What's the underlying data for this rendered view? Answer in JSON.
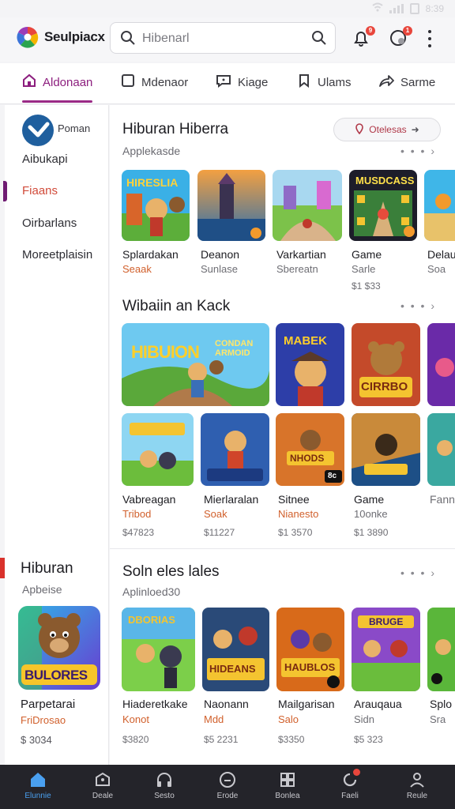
{
  "statusbar": {
    "time": "8:39"
  },
  "app": {
    "name": "Seulpiacx"
  },
  "search": {
    "placeholder": "Hibenarl"
  },
  "topbar": {
    "notif_badge": "9",
    "profile_badge": "1"
  },
  "tabs": [
    {
      "label": "Aldonaan",
      "icon": "home-icon",
      "active": true
    },
    {
      "label": "Mdenaor",
      "icon": "square-icon",
      "active": false
    },
    {
      "label": "Kiage",
      "icon": "chat-icon",
      "active": false
    },
    {
      "label": "Ulams",
      "icon": "bookmark-icon",
      "active": false
    },
    {
      "label": "Sarme",
      "icon": "share-icon",
      "active": false
    }
  ],
  "sidebar": {
    "avatar_label": "Poman",
    "items": [
      {
        "label": "Aibukapi",
        "active": false
      },
      {
        "label": "Fiaans",
        "active": true
      },
      {
        "label": "Oirbarlans",
        "active": false
      },
      {
        "label": "Moreetplaisin",
        "active": false
      }
    ],
    "bottom": {
      "title": "Hiburan",
      "subtitle": "Apbeise",
      "card_text": "BULORES",
      "card_title": "Parpetarai",
      "card_sub": "FriDrosao",
      "card_price": "$ 3034"
    }
  },
  "sections": [
    {
      "title": "Hiburan Hiberra",
      "subtitle": "Applekasde",
      "chip": "Otelesas",
      "items": [
        {
          "label": "Splardakan",
          "sub": "Seaak"
        },
        {
          "label": "Deanon",
          "sub": "Sunlase"
        },
        {
          "label": "Varkartian",
          "sub": "Sbereatn"
        },
        {
          "label": "Game",
          "sub": "Sarle",
          "price": "$1 $33"
        },
        {
          "label": "Delau",
          "sub": "Soa"
        }
      ],
      "banner_texts": [
        "HIRESLIA",
        "MUSDCASS"
      ]
    },
    {
      "title": "Wibaiin an Kack",
      "banners": [
        "HIBUION",
        "MABEK",
        "CIRRBO"
      ],
      "banner_small": "CONDAN ARMOID",
      "items": [
        {
          "label": "Vabreagan",
          "sub": "Tribod",
          "price": "$47823"
        },
        {
          "label": "Mierlaralan",
          "sub": "Soak",
          "price": "$11227"
        },
        {
          "label": "Sitnee",
          "sub": "Nianesto",
          "price": "$1 3570"
        },
        {
          "label": "Game",
          "sub": "10onke",
          "price": "$1 3890"
        },
        {
          "label": "Fann",
          "sub": ""
        }
      ],
      "tile_texts": [
        "NHODS",
        "8c"
      ]
    },
    {
      "title": "Soln eles lales",
      "subtitle": "Aplinloed30",
      "items": [
        {
          "label": "Hiaderetkake",
          "sub": "Konot",
          "price": "$3820"
        },
        {
          "label": "Naonann",
          "sub": "Mdd",
          "price": "$5 2231"
        },
        {
          "label": "Mailgarisan",
          "sub": "Salo",
          "price": "$3350"
        },
        {
          "label": "Arauqaua",
          "sub": "Sidn",
          "price": "$5 323"
        },
        {
          "label": "Splo",
          "sub": "Sra"
        }
      ],
      "tile_texts": [
        "DBORIAS",
        "HIDEANS",
        "HAUBLOS",
        "BRUGE"
      ]
    }
  ],
  "bottomnav": [
    {
      "label": "Elunnie",
      "icon": "home-icon",
      "active": true
    },
    {
      "label": "Deale",
      "icon": "tag-icon",
      "active": false
    },
    {
      "label": "Sesto",
      "icon": "headphones-icon",
      "active": false
    },
    {
      "label": "Erode",
      "icon": "circle-icon",
      "active": false
    },
    {
      "label": "Bonlea",
      "icon": "grid-icon",
      "active": false
    },
    {
      "label": "Faeli",
      "icon": "refresh-icon",
      "active": false
    },
    {
      "label": "Reule",
      "icon": "person-icon",
      "active": false
    }
  ],
  "colors": {
    "accent": "#8c1e7e",
    "active_nav": "#4aa0f0",
    "nav_bg": "#24242a",
    "badge": "#e8463c"
  }
}
